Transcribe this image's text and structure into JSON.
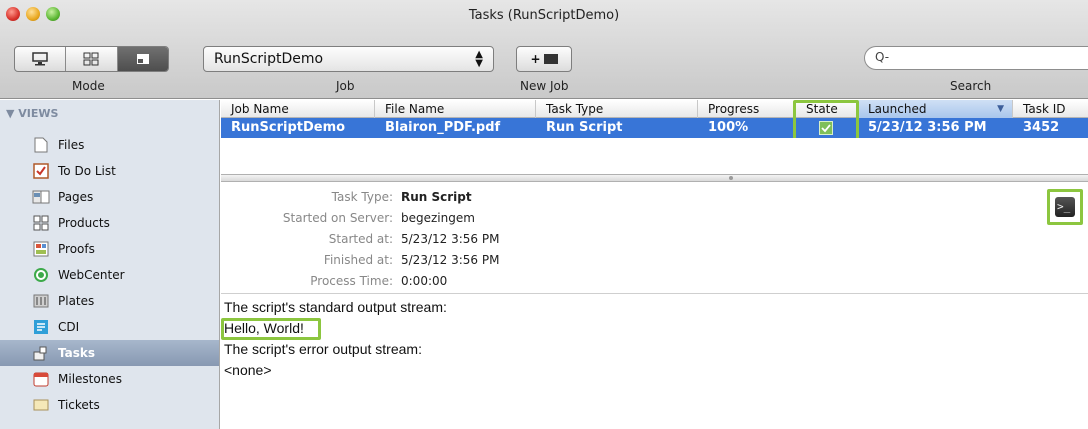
{
  "window": {
    "title": "Tasks (RunScriptDemo)"
  },
  "toolbar": {
    "mode_label": "Mode",
    "mode_buttons": [
      "computer-icon",
      "grid-icon",
      "tasks-icon"
    ],
    "job_value": "RunScriptDemo",
    "job_label": "Job",
    "new_job_button": "+",
    "new_job_label": "New Job",
    "search_placeholder": "Q-",
    "search_label": "Search"
  },
  "sidebar": {
    "header": "▼ VIEWS",
    "items": [
      {
        "label": "Files",
        "icon": "file-icon"
      },
      {
        "label": "To Do List",
        "icon": "todo-icon"
      },
      {
        "label": "Pages",
        "icon": "pages-icon"
      },
      {
        "label": "Products",
        "icon": "products-icon"
      },
      {
        "label": "Proofs",
        "icon": "proofs-icon"
      },
      {
        "label": "WebCenter",
        "icon": "webcenter-icon"
      },
      {
        "label": "Plates",
        "icon": "plates-icon"
      },
      {
        "label": "CDI",
        "icon": "cdi-icon"
      },
      {
        "label": "Tasks",
        "icon": "tasks-icon",
        "selected": true
      },
      {
        "label": "Milestones",
        "icon": "milestones-icon"
      },
      {
        "label": "Tickets",
        "icon": "tickets-icon"
      }
    ]
  },
  "table": {
    "columns": [
      "Job Name",
      "File Name",
      "Task Type",
      "Progress",
      "State",
      "Launched",
      "Task ID"
    ],
    "sorted_column": "Launched",
    "rows": [
      {
        "job_name": "RunScriptDemo",
        "file_name": "Blairon_PDF.pdf",
        "task_type": "Run Script",
        "progress": "100%",
        "state": "check-icon",
        "launched": "5/23/12 3:56 PM",
        "task_id": "3452"
      }
    ]
  },
  "details": {
    "task_type_label": "Task Type:",
    "task_type": "Run Script",
    "server_label": "Started on Server:",
    "server": "begezingem",
    "started_label": "Started at:",
    "started": "5/23/12 3:56 PM",
    "finished_label": "Finished at:",
    "finished": "5/23/12 3:56 PM",
    "process_label": "Process Time:",
    "process": "0:00:00"
  },
  "output": {
    "stdout_header": "The script's standard output stream:",
    "stdout": "Hello, World!",
    "stderr_header": "The script's error output stream:",
    "stderr": "<none>"
  },
  "colors": {
    "selection": "#3875d7",
    "highlight": "#8cc63f",
    "sidebar": "#dfe5ed"
  }
}
